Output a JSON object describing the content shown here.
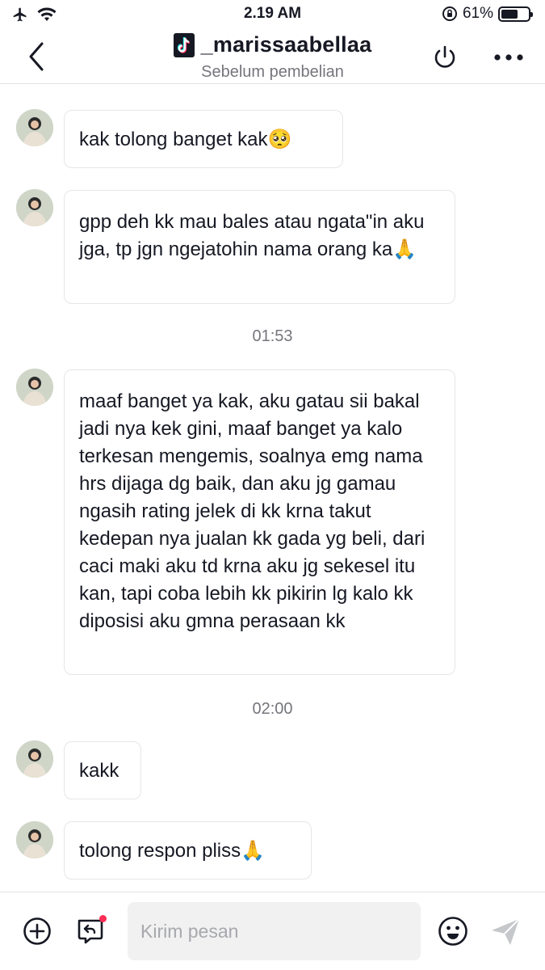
{
  "status_bar": {
    "time": "2.19 AM",
    "battery_percent_label": "61%",
    "battery_level": 0.61
  },
  "header": {
    "title": "_marissaabellaa",
    "subtitle": "Sebelum pembelian",
    "brand_icon": "tiktok-icon"
  },
  "messages": [
    {
      "text": "kak tolong banget kak🥺"
    },
    {
      "text": "gpp deh kk mau bales atau ngata\"in aku jga, tp jgn ngejatohin nama orang ka🙏"
    },
    {
      "text": "maaf banget ya kak, aku gatau sii bakal jadi nya kek gini, maaf banget ya kalo terkesan mengemis, soalnya emg nama hrs dijaga dg baik, dan aku jg gamau ngasih rating jelek di kk krna takut kedepan nya jualan kk gada yg beli, dari caci maki aku td krna aku jg sekesel itu kan, tapi coba lebih kk pikirin lg kalo kk diposisi aku gmna perasaan kk"
    },
    {
      "text": "kakk"
    },
    {
      "text": "tolong respon pliss🙏"
    }
  ],
  "timestamps": [
    "01:53",
    "02:00"
  ],
  "composer": {
    "placeholder": "Kirim pesan"
  },
  "colors": {
    "text": "#161823",
    "muted": "#75767c",
    "input_bg": "#f1f1f2",
    "notification_dot": "#fe2c55"
  }
}
